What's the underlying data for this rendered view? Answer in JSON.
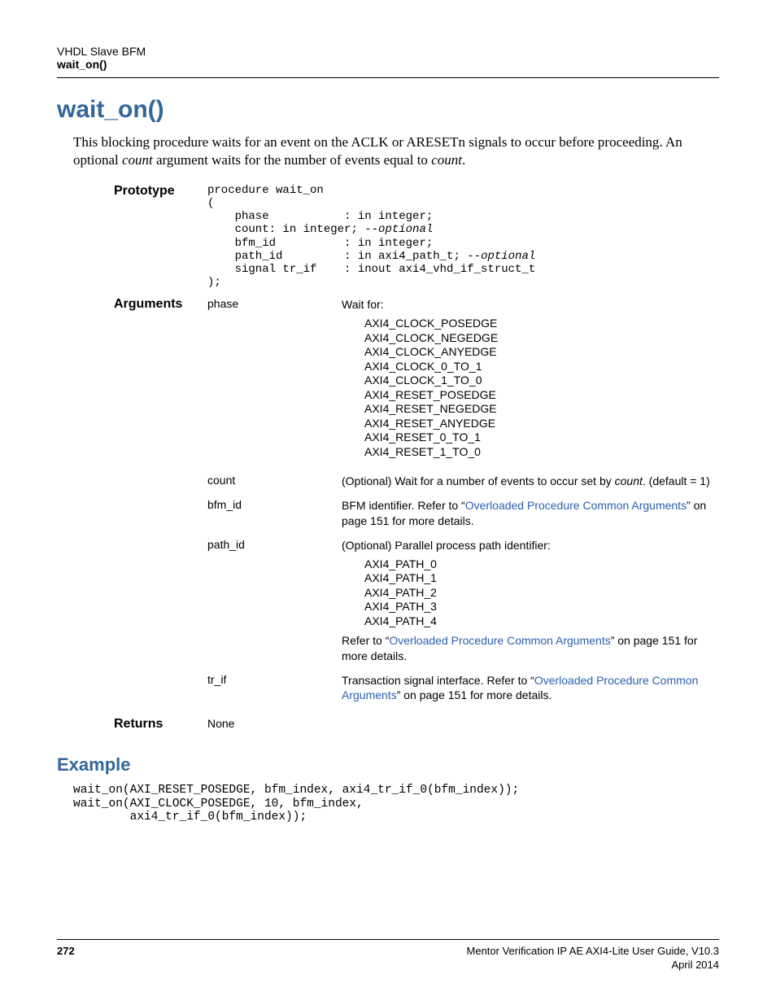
{
  "header": {
    "line1": "VHDL Slave BFM",
    "line2": "wait_on()"
  },
  "title": "wait_on()",
  "intro_plain_1": "This blocking procedure waits for an event on the ACLK or ARESETn signals to occur before proceeding. An optional ",
  "intro_italic_1": "count",
  "intro_plain_2": " argument waits for the number of events equal to ",
  "intro_italic_2": "count",
  "intro_plain_3": ".",
  "prototype_label": "Prototype",
  "prototype_code_1": "procedure wait_on\n(\n    phase           : in integer;\n    count: in integer; ",
  "prototype_comment_1": "--optional",
  "prototype_code_2": "\n    bfm_id          : in integer;\n    path_id         : in axi4_path_t; ",
  "prototype_comment_2": "--optional",
  "prototype_code_3": "\n    signal tr_if    : inout axi4_vhd_if_struct_t\n);",
  "arguments_label": "Arguments",
  "args": {
    "phase": {
      "name": "phase",
      "desc_lead": "Wait for:",
      "enums": "AXI4_CLOCK_POSEDGE\nAXI4_CLOCK_NEGEDGE\nAXI4_CLOCK_ANYEDGE\nAXI4_CLOCK_0_TO_1\nAXI4_CLOCK_1_TO_0\nAXI4_RESET_POSEDGE\nAXI4_RESET_NEGEDGE\nAXI4_RESET_ANYEDGE\nAXI4_RESET_0_TO_1\nAXI4_RESET_1_TO_0"
    },
    "count": {
      "name": "count",
      "desc_1": "(Optional) Wait for a number of events to occur set by ",
      "desc_italic": "count",
      "desc_2": ". (default = 1)"
    },
    "bfm_id": {
      "name": "bfm_id",
      "desc_1": "BFM identifier. Refer to “",
      "link": "Overloaded Procedure Common Arguments",
      "desc_2": "” on page 151 for more details."
    },
    "path_id": {
      "name": "path_id",
      "desc_lead": "(Optional) Parallel process path identifier:",
      "enums": "AXI4_PATH_0\nAXI4_PATH_1\nAXI4_PATH_2\nAXI4_PATH_3\nAXI4_PATH_4",
      "desc_1": "Refer to “",
      "link": "Overloaded Procedure Common Arguments",
      "desc_2": "” on page 151 for more details."
    },
    "tr_if": {
      "name": "tr_if",
      "desc_1": "Transaction signal interface. Refer to “",
      "link": "Overloaded Procedure Common Arguments",
      "desc_2": "” on page 151 for more details."
    }
  },
  "returns_label": "Returns",
  "returns_value": "None",
  "example_heading": "Example",
  "example_code": "wait_on(AXI_RESET_POSEDGE, bfm_index, axi4_tr_if_0(bfm_index));\nwait_on(AXI_CLOCK_POSEDGE, 10, bfm_index,\n        axi4_tr_if_0(bfm_index));",
  "footer": {
    "page": "272",
    "right1": "Mentor Verification IP AE AXI4-Lite User Guide, V10.3",
    "right2": "April 2014"
  }
}
